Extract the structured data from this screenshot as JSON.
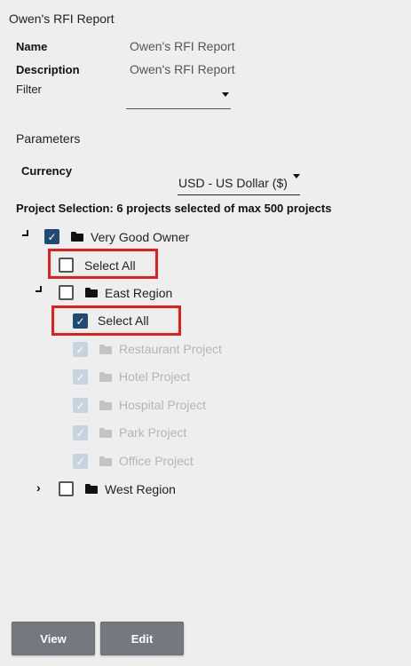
{
  "report": {
    "title": "Owen's RFI Report",
    "name_label": "Name",
    "name_value": "Owen's RFI Report",
    "description_label": "Description",
    "description_value": "Owen's RFI Report",
    "filter_label": "Filter",
    "filter_value": ""
  },
  "parameters": {
    "heading": "Parameters",
    "currency_label": "Currency",
    "currency_value": "USD - US Dollar ($)",
    "project_selection": "Project Selection: 6 projects selected of max 500 projects"
  },
  "tree": {
    "owner": {
      "label": "Very Good Owner",
      "checked": true
    },
    "owner_select_all": {
      "label": "Select All",
      "checked": false
    },
    "east_region": {
      "label": "East Region",
      "checked": false
    },
    "east_select_all": {
      "label": "Select All",
      "checked": true
    },
    "projects": [
      {
        "label": "Restaurant Project",
        "checked": true,
        "disabled": true
      },
      {
        "label": "Hotel Project",
        "checked": true,
        "disabled": true
      },
      {
        "label": "Hospital Project",
        "checked": true,
        "disabled": true
      },
      {
        "label": "Park Project",
        "checked": true,
        "disabled": true
      },
      {
        "label": "Office Project",
        "checked": true,
        "disabled": true
      }
    ],
    "west_region": {
      "label": "West Region",
      "checked": false
    }
  },
  "buttons": {
    "view_label": "View",
    "edit_label": "Edit"
  },
  "colors": {
    "checkbox_checked": "#1e4a74",
    "checkbox_disabled": "#c6d4e0",
    "highlight": "#e0201c",
    "button": "#74797f"
  }
}
